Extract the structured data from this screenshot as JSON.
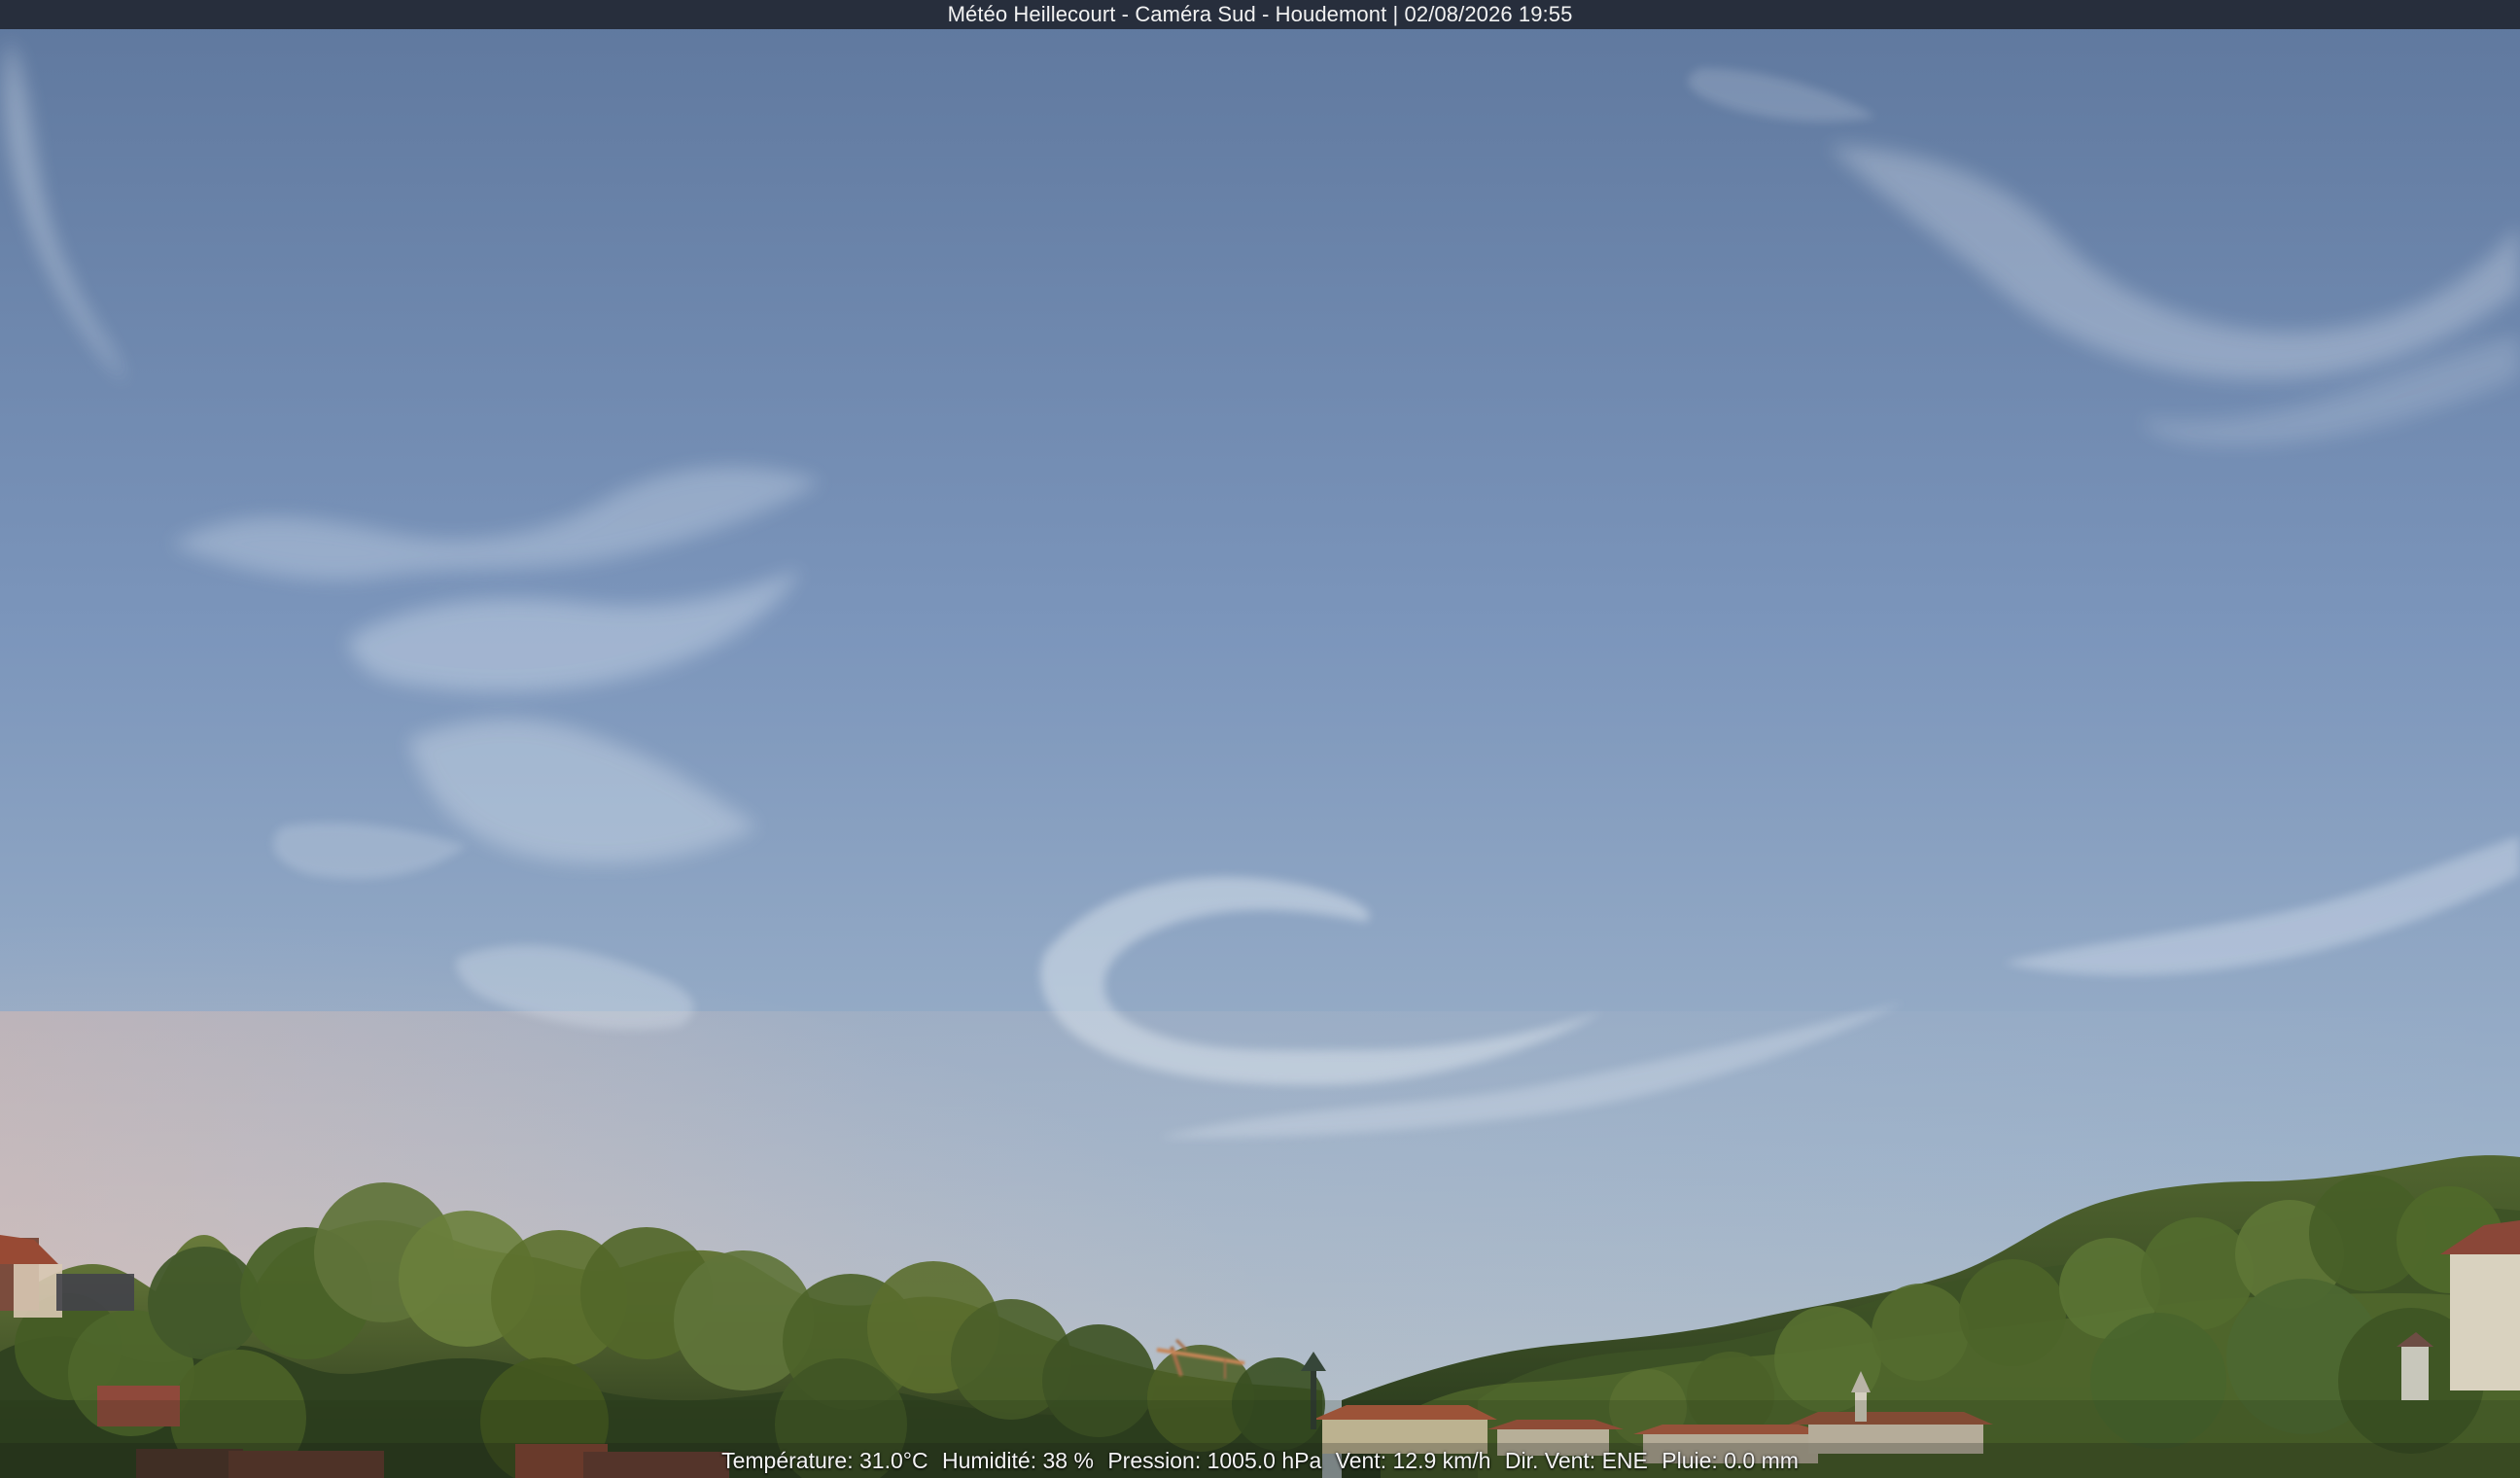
{
  "overlay": {
    "title": "Météo Heillecourt - Caméra Sud - Houdemont | 02/08/2026 19:55",
    "weather": [
      "Température: 31.0°C",
      "Humidité: 38 %",
      "Pression: 1005.0 hPa",
      "Vent: 12.9 km/h",
      "Dir. Vent: ENE",
      "Pluie: 0.0 mm"
    ]
  },
  "colors": {
    "sky_top": "#657ca1",
    "sky_bottom": "#a9b8c8",
    "horizon_warm": "#d8c6bd",
    "trees_dark": "#33451f",
    "trees_light": "#6c7f3b",
    "roof": "#9f4e34"
  }
}
